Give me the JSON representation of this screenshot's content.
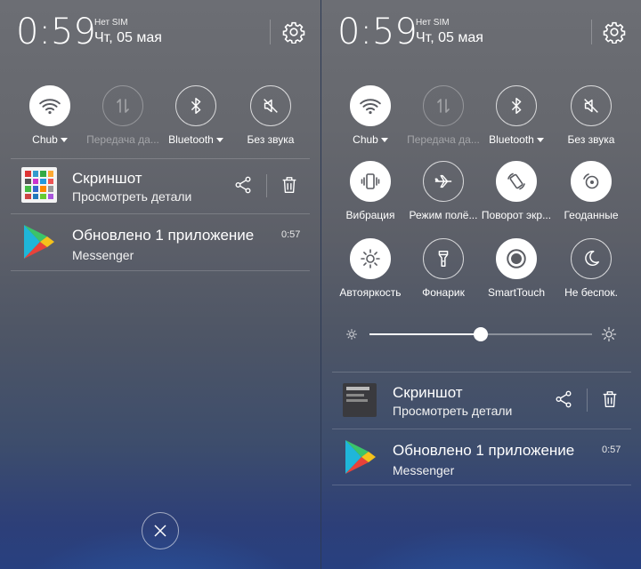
{
  "status": {
    "time": "0:59",
    "sim": "Нет SIM",
    "date": "Чт, 05 мая"
  },
  "toggles": {
    "wifi": "Chub",
    "data": "Передача да...",
    "bluetooth": "Bluetooth",
    "silent": "Без звука",
    "vibration": "Вибрация",
    "airplane": "Режим полё...",
    "rotation": "Поворот экр...",
    "location": "Геоданные",
    "autobright": "Автояркость",
    "flashlight": "Фонарик",
    "smarttouch": "SmartTouch",
    "dnd": "Не беспок."
  },
  "brightness": {
    "level": 0.5
  },
  "notifications": {
    "screenshot": {
      "title": "Скриншот",
      "subtitle": "Просмотреть детали"
    },
    "update": {
      "title": "Обновлено 1 приложение",
      "subtitle": "Messenger",
      "time": "0:57"
    }
  },
  "colors": {
    "accent": "#ffffff",
    "icon_on": "#5a5c62",
    "bg_top": "#6c6e74",
    "bg_bottom": "#284080"
  }
}
